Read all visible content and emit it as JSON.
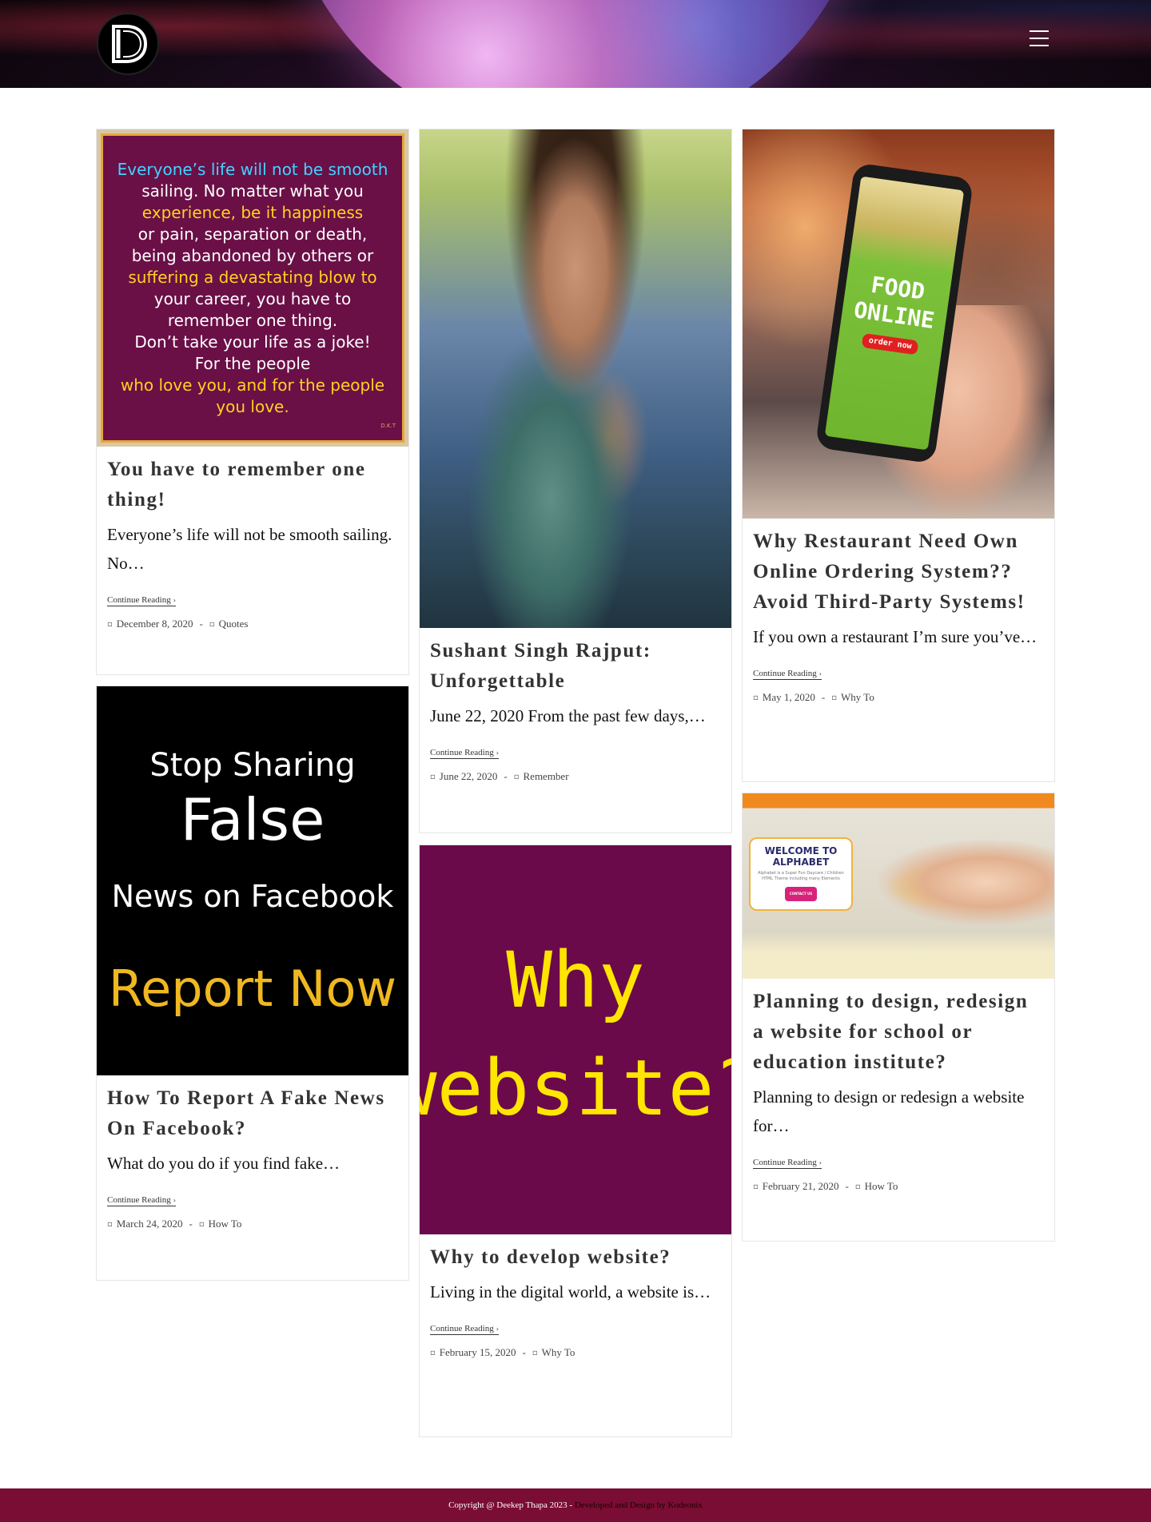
{
  "header": {
    "logo_alt": "D",
    "menu_icon": "hamburger-menu-icon"
  },
  "posts": [
    {
      "title": "You have to remember one thing!",
      "excerpt": "Everyone’s life will not be smooth sailing. No…",
      "read_more": "Continue Reading",
      "date": "December 8, 2020",
      "category": "Quotes",
      "image_text": {
        "lines": [
          "Everyone’s life will not be smooth",
          "sailing. No matter what you",
          "experience, be it happiness",
          "or pain, separation or death,",
          "being abandoned by others or",
          "suffering a devastating blow to",
          "your career, you have to",
          "remember one thing.",
          "Don’t take your life as a joke!",
          "For the people",
          "who love you, and for the people",
          "you love."
        ],
        "signature": "D.K.T"
      }
    },
    {
      "title": "How To Report A Fake News On Facebook?",
      "excerpt": "What do you do if you find fake…",
      "read_more": "Continue Reading",
      "date": "March 24, 2020",
      "category": "How To",
      "image_text": {
        "line1": "Stop Sharing",
        "line2": "False",
        "line3": "News on Facebook",
        "line4": "Report Now"
      }
    },
    {
      "title": "Sushant Singh Rajput: Unforgettable",
      "excerpt": "June 22, 2020 From the past few days,…",
      "read_more": "Continue Reading",
      "date": "June 22, 2020",
      "category": "Remember"
    },
    {
      "title": "Why to develop website?",
      "excerpt": "Living in the digital world, a website is…",
      "read_more": "Continue Reading",
      "date": "February 15, 2020",
      "category": "Why To",
      "image_text": {
        "line1": "Why",
        "line2": "website?"
      }
    },
    {
      "title": "Why Restaurant Need Own Online Ordering System?? Avoid Third-Party Systems!",
      "excerpt": "If you own a restaurant I’m sure you’ve…",
      "read_more": "Continue Reading",
      "date": "May 1, 2020",
      "category": "Why To",
      "image_text": {
        "line1": "FOOD",
        "line2": "ONLINE",
        "button": "order now"
      }
    },
    {
      "title": "Planning to design, redesign a website for school or education institute?",
      "excerpt": "Planning to design or redesign a website for…",
      "read_more": "Continue Reading",
      "date": "February 21, 2020",
      "category": "How To",
      "image_text": {
        "heading": "WELCOME TO ALPHABET",
        "sub": "Alphabet is a Super Fun Daycare / Children HTML Theme including many Elements",
        "button": "CONTACT US"
      }
    }
  ],
  "footer": {
    "copyright": "Copyright @ Deekep Thapa 2023 -",
    "developer": "Developed and Design by Kodeonix"
  },
  "colors": {
    "footer_bg": "#7a0d33",
    "quote_bg": "#6b0f47",
    "why_bg": "#6b0a4a",
    "accent_yellow": "#ffe600"
  }
}
